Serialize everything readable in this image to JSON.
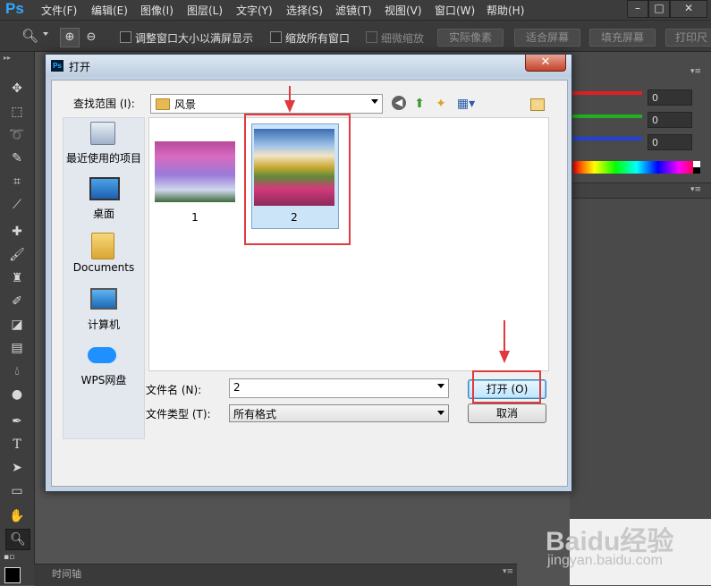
{
  "app": {
    "logo_text": "Ps",
    "menu": [
      "文件(F)",
      "编辑(E)",
      "图像(I)",
      "图层(L)",
      "文字(Y)",
      "选择(S)",
      "滤镜(T)",
      "视图(V)",
      "窗口(W)",
      "帮助(H)"
    ],
    "window_controls": [
      "–",
      "□",
      "✕"
    ]
  },
  "options_bar": {
    "checkbox_resize": "调整窗口大小以满屏显示",
    "checkbox_zoom_all": "缩放所有窗口",
    "checkbox_scrubby": "细微缩放",
    "btn_actual": "实际像素",
    "btn_fit": "适合屏幕",
    "btn_fill": "填充屏幕",
    "btn_print": "打印尺"
  },
  "color_panel": {
    "r_value": "0",
    "g_value": "0",
    "b_value": "0",
    "colors": {
      "r": "#e02020",
      "g": "#20b020",
      "b": "#2040e0"
    }
  },
  "timeline": {
    "tab_label": "时间轴"
  },
  "dialog": {
    "title": "打开",
    "close_glyph": "✕",
    "look_in_label": "查找范围 (I):",
    "look_in_value": "风景",
    "places": [
      {
        "label": "最近使用的项目",
        "icon": "recent-items-icon"
      },
      {
        "label": "桌面",
        "icon": "desktop-icon"
      },
      {
        "label": "Documents",
        "icon": "documents-folder-icon"
      },
      {
        "label": "计算机",
        "icon": "computer-icon"
      },
      {
        "label": "WPS网盘",
        "icon": "wps-cloud-icon"
      }
    ],
    "files": [
      {
        "name": "1",
        "selected": false
      },
      {
        "name": "2",
        "selected": true
      }
    ],
    "filename_label": "文件名 (N):",
    "filename_value": "2",
    "filetype_label": "文件类型 (T):",
    "filetype_value": "所有格式",
    "open_button": "打开 (O)",
    "cancel_button": "取消"
  },
  "watermark": {
    "logo": "Baidu经验",
    "url": "jingyan.baidu.com"
  }
}
